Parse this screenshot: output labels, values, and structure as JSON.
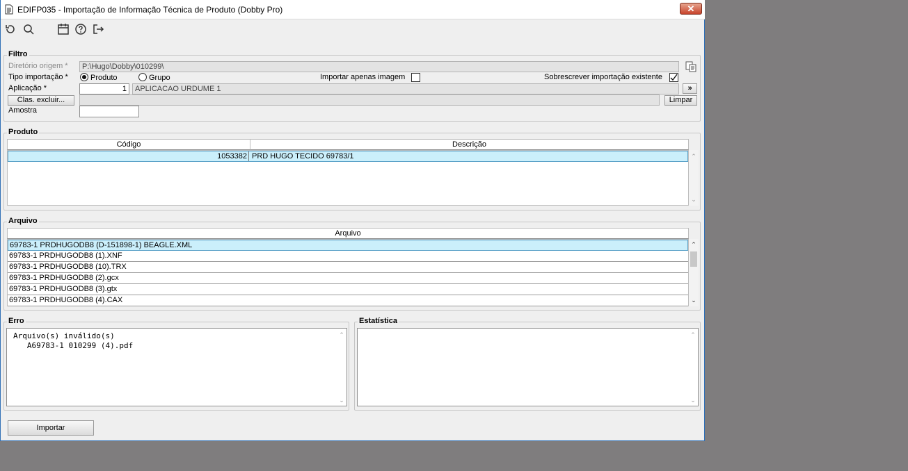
{
  "window": {
    "title": "EDIFP035 - Importação de Informação Técnica de Produto (Dobby Pro)",
    "close_label": "✕"
  },
  "toolbar": {
    "icons": [
      "refresh-icon",
      "search-icon",
      "calendar-icon",
      "help-icon",
      "exit-icon"
    ]
  },
  "filtro": {
    "legend": "Filtro",
    "diretorio_label": "Diretório origem *",
    "diretorio_value": "P:\\Hugo\\Dobby\\010299\\",
    "tipo_label": "Tipo importação *",
    "radio_produto": "Produto",
    "radio_grupo": "Grupo",
    "selected": "Produto",
    "importar_imagem_label": "Importar apenas imagem",
    "importar_imagem_checked": false,
    "sobrescrever_label": "Sobrescrever importação existente",
    "sobrescrever_checked": true,
    "aplicacao_label": "Aplicação *",
    "aplicacao_code": "1",
    "aplicacao_desc": "APLICACAO URDUME 1",
    "aplicacao_button": "»",
    "clas_button": "Clas. excluir...",
    "clas_value": "",
    "limpar_button": "Limpar",
    "amostra_label": "Amostra",
    "amostra_value": ""
  },
  "produto": {
    "legend": "Produto",
    "columns": [
      "Código",
      "Descrição"
    ],
    "rows": [
      {
        "codigo": "1053382",
        "descricao": "PRD HUGO TECIDO 69783/1"
      }
    ]
  },
  "arquivo": {
    "legend": "Arquivo",
    "column": "Arquivo",
    "rows": [
      "69783-1 PRDHUGODB8  (D-151898-1) BEAGLE.XML",
      "69783-1 PRDHUGODB8 (1).XNF",
      "69783-1 PRDHUGODB8 (10).TRX",
      "69783-1 PRDHUGODB8 (2).gcx",
      "69783-1 PRDHUGODB8 (3).gtx",
      "69783-1 PRDHUGODB8 (4).CAX"
    ]
  },
  "erro": {
    "legend": "Erro",
    "line1": "Arquivo(s) inválido(s)",
    "line2": "   A69783-1 010299 (4).pdf"
  },
  "estatistica": {
    "legend": "Estatística",
    "text": ""
  },
  "importar_button": "Importar"
}
